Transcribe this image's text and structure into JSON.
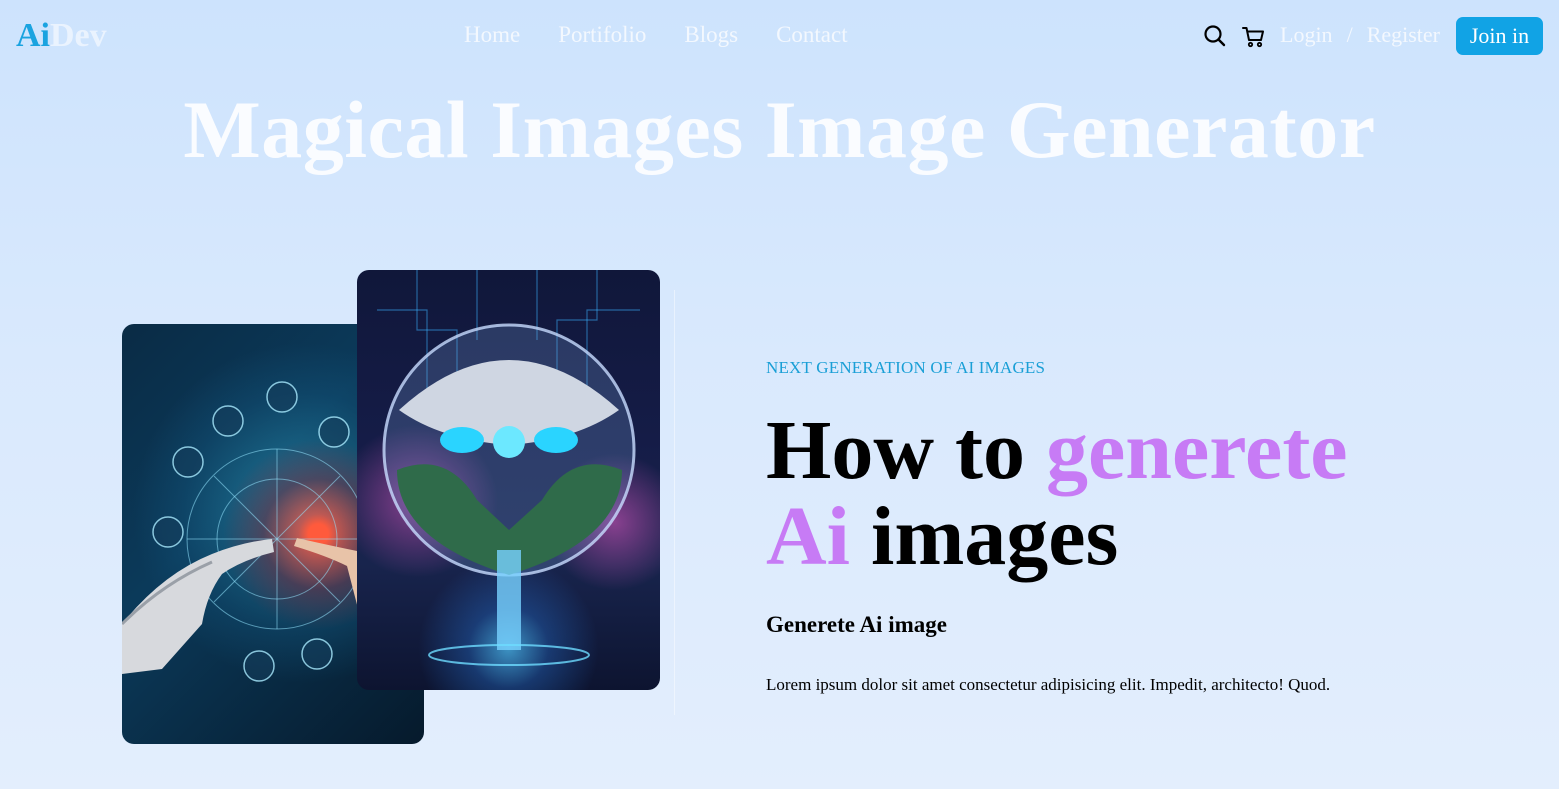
{
  "header": {
    "logo_part1": "Ai",
    "logo_part2": "Dev",
    "nav": [
      "Home",
      "Portifolio",
      "Blogs",
      "Contact"
    ],
    "icons": [
      "search-icon",
      "cart-icon"
    ],
    "login_label": "Login",
    "separator": "/",
    "register_label": "Register",
    "join_label": "Join in"
  },
  "hero": {
    "title": "Magical Images Image Generator"
  },
  "content": {
    "eyebrow": "NEXT GENERATION OF AI IMAGES",
    "headline_part1": "How to ",
    "headline_accent1": "generete",
    "headline_accent2": "Ai",
    "headline_part2": " images",
    "subhead": "Generete Ai image",
    "body": "Lorem ipsum dolor sit amet consectetur adipisicing elit. Impedit, architecto! Quod."
  },
  "colors": {
    "accent_blue": "#11a3e5",
    "accent_purple": "#c77bf5",
    "background": "#d9e9fd"
  }
}
